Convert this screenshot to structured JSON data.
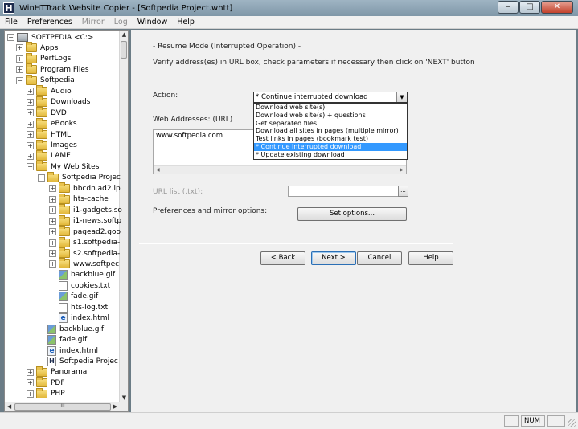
{
  "window": {
    "title": "WinHTTrack Website Copier - [Softpedia Project.whtt]",
    "app_icon_letter": "H",
    "min_glyph": "–",
    "max_glyph": "□",
    "close_glyph": "✕"
  },
  "menu": [
    {
      "label": "File",
      "disabled": false
    },
    {
      "label": "Preferences",
      "disabled": false
    },
    {
      "label": "Mirror",
      "disabled": true
    },
    {
      "label": "Log",
      "disabled": true
    },
    {
      "label": "Window",
      "disabled": false
    },
    {
      "label": "Help",
      "disabled": false
    }
  ],
  "tree": [
    {
      "label": "SOFTPEDIA <C:>",
      "level": 0,
      "kind": "drive",
      "expander": "−"
    },
    {
      "label": "Apps",
      "level": 1,
      "kind": "folder",
      "expander": "+"
    },
    {
      "label": "PerfLogs",
      "level": 1,
      "kind": "folder",
      "expander": "+"
    },
    {
      "label": "Program Files",
      "level": 1,
      "kind": "folder",
      "expander": "+"
    },
    {
      "label": "Softpedia",
      "level": 1,
      "kind": "folder",
      "expander": "−"
    },
    {
      "label": "Audio",
      "level": 2,
      "kind": "folder",
      "expander": "+"
    },
    {
      "label": "Downloads",
      "level": 2,
      "kind": "folder",
      "expander": "+"
    },
    {
      "label": "DVD",
      "level": 2,
      "kind": "folder",
      "expander": "+"
    },
    {
      "label": "eBooks",
      "level": 2,
      "kind": "folder",
      "expander": "+"
    },
    {
      "label": "HTML",
      "level": 2,
      "kind": "folder",
      "expander": "+"
    },
    {
      "label": "Images",
      "level": 2,
      "kind": "folder",
      "expander": "+"
    },
    {
      "label": "LAME",
      "level": 2,
      "kind": "folder",
      "expander": "+"
    },
    {
      "label": "My Web Sites",
      "level": 2,
      "kind": "folder",
      "expander": "−"
    },
    {
      "label": "Softpedia Projec",
      "level": 3,
      "kind": "folder",
      "expander": "−"
    },
    {
      "label": "bbcdn.ad2.ip",
      "level": 4,
      "kind": "folder",
      "expander": "+"
    },
    {
      "label": "hts-cache",
      "level": 4,
      "kind": "folder",
      "expander": "+"
    },
    {
      "label": "i1-gadgets.so",
      "level": 4,
      "kind": "folder",
      "expander": "+"
    },
    {
      "label": "i1-news.softp",
      "level": 4,
      "kind": "folder",
      "expander": "+"
    },
    {
      "label": "pagead2.goo",
      "level": 4,
      "kind": "folder",
      "expander": "+"
    },
    {
      "label": "s1.softpedia-",
      "level": 4,
      "kind": "folder",
      "expander": "+"
    },
    {
      "label": "s2.softpedia-",
      "level": 4,
      "kind": "folder",
      "expander": "+"
    },
    {
      "label": "www.softpec",
      "level": 4,
      "kind": "folder",
      "expander": "+"
    },
    {
      "label": "backblue.gif",
      "level": 4,
      "kind": "gif",
      "expander": ""
    },
    {
      "label": "cookies.txt",
      "level": 4,
      "kind": "txt",
      "expander": ""
    },
    {
      "label": "fade.gif",
      "level": 4,
      "kind": "gif",
      "expander": ""
    },
    {
      "label": "hts-log.txt",
      "level": 4,
      "kind": "txt",
      "expander": ""
    },
    {
      "label": "index.html",
      "level": 4,
      "kind": "html",
      "expander": ""
    },
    {
      "label": "backblue.gif",
      "level": 3,
      "kind": "gif",
      "expander": ""
    },
    {
      "label": "fade.gif",
      "level": 3,
      "kind": "gif",
      "expander": ""
    },
    {
      "label": "index.html",
      "level": 3,
      "kind": "html",
      "expander": ""
    },
    {
      "label": "Softpedia Projec",
      "level": 3,
      "kind": "whtt",
      "expander": ""
    },
    {
      "label": "Panorama",
      "level": 2,
      "kind": "folder",
      "expander": "+"
    },
    {
      "label": "PDF",
      "level": 2,
      "kind": "folder",
      "expander": "+"
    },
    {
      "label": "PHP",
      "level": 2,
      "kind": "folder",
      "expander": "+"
    }
  ],
  "tree_scroll": {
    "up": "▲",
    "down": "▼",
    "left": "◀",
    "right": "▶",
    "hthumb": "III"
  },
  "panel": {
    "mode_title": "- Resume Mode (Interrupted Operation) -",
    "instructions": "Verify address(es) in URL box, check parameters if necessary then click on 'NEXT' button",
    "action_label": "Action:",
    "action_value": "* Continue interrupted download",
    "dropdown_arrow": "▼",
    "action_options": [
      "Download web site(s)",
      "Download web site(s) + questions",
      "Get separated files",
      "Download all sites in pages (multiple mirror)",
      "Test links in pages (bookmark test)",
      "* Continue interrupted download",
      "* Update existing download"
    ],
    "selected_option_index": 5,
    "web_addresses_label": "Web Addresses: (URL)",
    "url_value": "www.softpedia.com",
    "url_scroll_left": "◀",
    "url_scroll_right": "▶",
    "url_list_label": "URL list (.txt):",
    "browse_label": "...",
    "prefs_label": "Preferences and mirror options:",
    "set_options_button": "Set options...",
    "back_button": "< Back",
    "next_button": "Next >",
    "cancel_button": "Cancel",
    "help_button": "Help"
  },
  "status": {
    "num": "NUM"
  }
}
